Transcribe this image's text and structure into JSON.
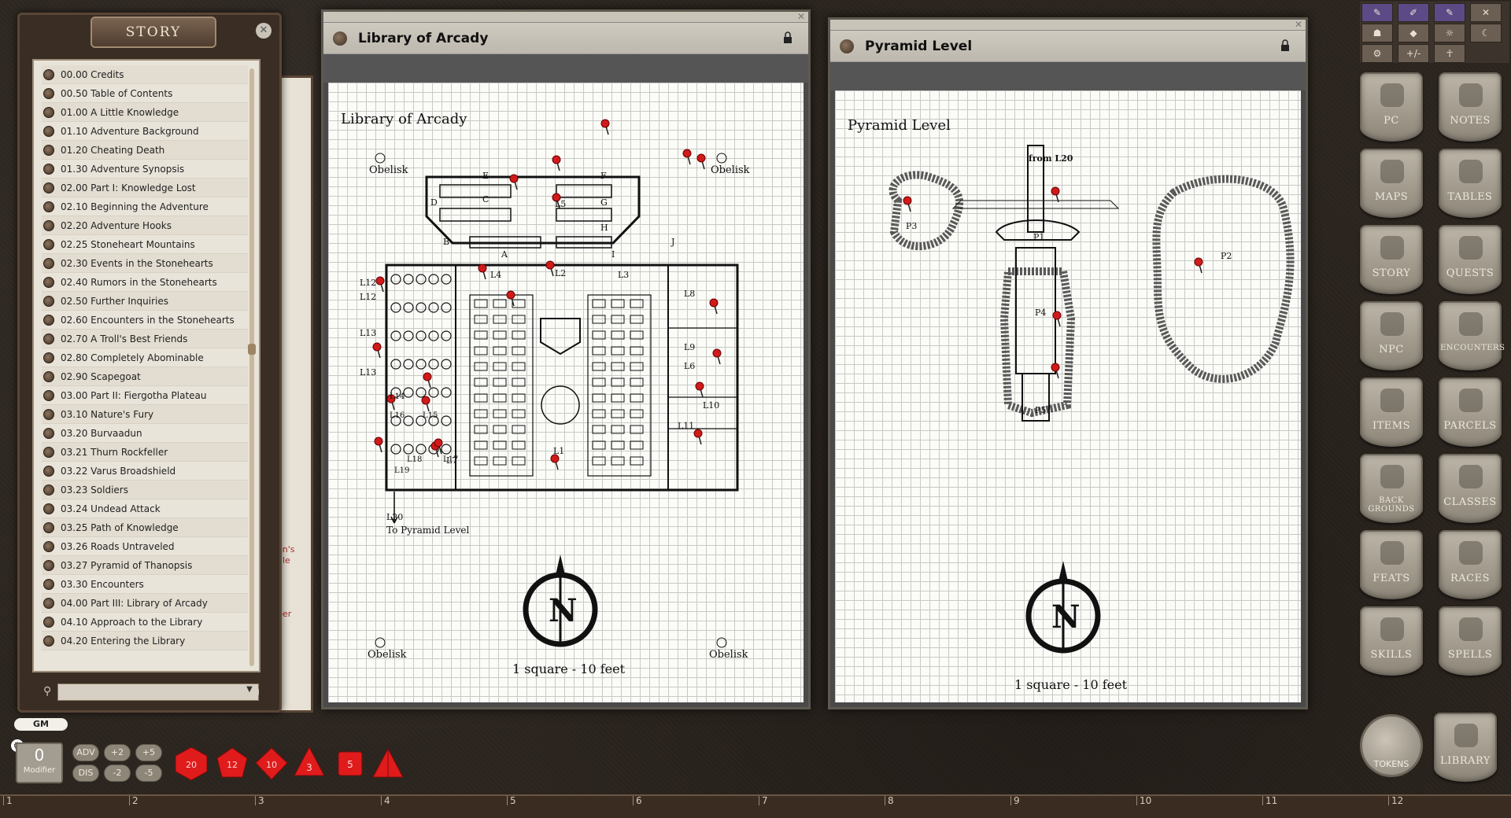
{
  "story_panel": {
    "title": "STORY",
    "items": [
      "00.00 Credits",
      "00.50 Table of Contents",
      "01.00 A Little Knowledge",
      "01.10 Adventure Background",
      "01.20 Cheating Death",
      "01.30 Adventure Synopsis",
      "02.00 Part I: Knowledge Lost",
      "02.10 Beginning the Adventure",
      "02.20 Adventure Hooks",
      "02.25 Stoneheart Mountains",
      "02.30 Events in the Stonehearts",
      "02.40 Rumors in the Stonehearts",
      "02.50 Further Inquiries",
      "02.60 Encounters in the Stonehearts",
      "02.70 A Troll's Best Friends",
      "02.80 Completely Abominable",
      "02.90 Scapegoat",
      "03.00 Part II: Fiergotha Plateau",
      "03.10 Nature's Fury",
      "03.20 Burvaadun",
      "03.21 Thurn Rockfeller",
      "03.22 Varus Broadshield",
      "03.23 Soldiers",
      "03.24 Undead Attack",
      "03.25 Path of Knowledge",
      "03.26 Roads Untraveled",
      "03.27 Pyramid of Thanopsis",
      "03.30 Encounters",
      "04.00 Part III: Library of Arcady",
      "04.10 Approach to the Library",
      "04.20 Entering the Library"
    ],
    "behind_text": [
      "en's",
      "ule",
      "per"
    ]
  },
  "map_library": {
    "window_title": "Library of Arcady",
    "map_title": "Library of Arcady",
    "obelisk": "Obelisk",
    "scale": "1 square - 10 feet",
    "compass": "N",
    "stairs_label": "To Pyramid Level",
    "room_labels": [
      "A",
      "B",
      "C",
      "D",
      "E",
      "F",
      "G",
      "H",
      "I",
      "J",
      "L1",
      "L2",
      "L3",
      "L4",
      "L5",
      "L6",
      "L7",
      "L8",
      "L9",
      "L10",
      "L11",
      "L12",
      "L12",
      "L13",
      "L13",
      "L14",
      "L15",
      "L16",
      "L17",
      "L18",
      "L19",
      "L20"
    ]
  },
  "map_pyramid": {
    "window_title": "Pyramid Level",
    "map_title": "Pyramid Level",
    "scale": "1 square - 10 feet",
    "compass": "N",
    "from_label": "from L20",
    "room_labels": [
      "P1",
      "P2",
      "P3",
      "P4",
      "P5"
    ]
  },
  "sidebar": {
    "top_tools": [
      "+/-"
    ],
    "buttons": [
      {
        "label": "PC",
        "icon": "helmet-icon"
      },
      {
        "label": "NOTES",
        "icon": "quill-icon"
      },
      {
        "label": "MAPS",
        "icon": "map-icon"
      },
      {
        "label": "TABLES",
        "icon": "scroll-icon"
      },
      {
        "label": "STORY",
        "icon": "masks-icon"
      },
      {
        "label": "QUESTS",
        "icon": "masks-icon"
      },
      {
        "label": "NPC",
        "icon": "demon-icon"
      },
      {
        "label": "ENCOUNTERS",
        "icon": "demon-icon"
      },
      {
        "label": "ITEMS",
        "icon": "swords-icon"
      },
      {
        "label": "PARCELS",
        "icon": "swords-icon"
      },
      {
        "label": "BACK GROUNDS",
        "icon": "book-icon"
      },
      {
        "label": "CLASSES",
        "icon": "book-icon"
      },
      {
        "label": "FEATS",
        "icon": "book-icon"
      },
      {
        "label": "RACES",
        "icon": "book-icon"
      },
      {
        "label": "SKILLS",
        "icon": "book-icon"
      },
      {
        "label": "SPELLS",
        "icon": "book-icon"
      }
    ],
    "tokens": "TOKENS",
    "library": "LIBRARY"
  },
  "dice_bar": {
    "gm_label": "GM",
    "modifier_value": "0",
    "modifier_label": "Modifier",
    "mods": [
      "ADV",
      "+2",
      "+5",
      "DIS",
      "-2",
      "-5"
    ],
    "die_color": "#e01b1b"
  },
  "ruler": [
    "1",
    "2",
    "3",
    "4",
    "5",
    "6",
    "7",
    "8",
    "9",
    "10",
    "11",
    "12"
  ]
}
